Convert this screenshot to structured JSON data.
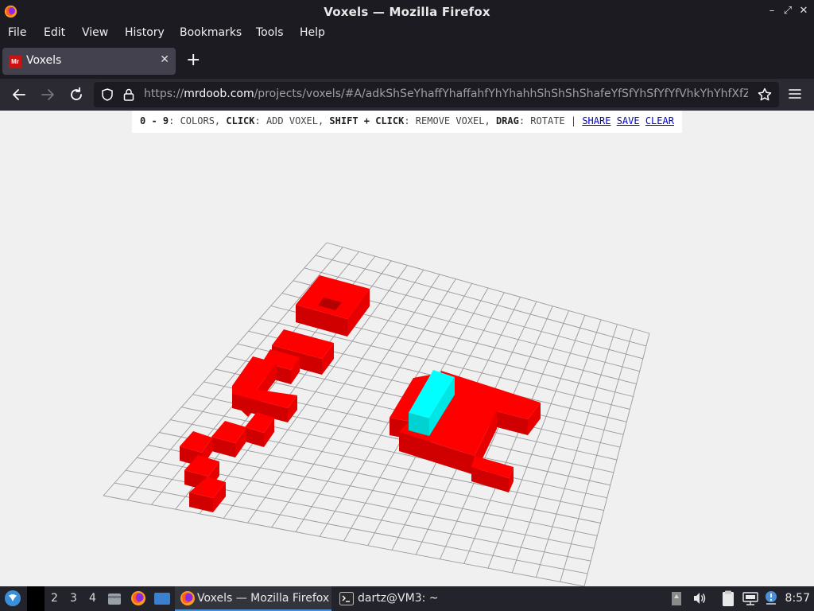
{
  "window": {
    "title": "Voxels — Mozilla Firefox"
  },
  "menu": [
    "File",
    "Edit",
    "View",
    "History",
    "Bookmarks",
    "Tools",
    "Help"
  ],
  "tab": {
    "label": "Voxels",
    "favicon_text": "Mr"
  },
  "url": {
    "prefix": "https://",
    "domain": "mrdoob.com",
    "path": "/projects/voxels/#A/adkShSeYhaffYhaffahfYhYhahhShShShShafeYfSfYhSfYfYfVhkYhYhfXfZ"
  },
  "info": {
    "k1": "0 - 9",
    "t1": ": COLORS, ",
    "k2": "CLICK",
    "t2": ": ADD VOXEL, ",
    "k3": "SHIFT + CLICK",
    "t3": ": REMOVE VOXEL, ",
    "k4": "DRAG",
    "t4": ": ROTATE | ",
    "share": "SHARE",
    "save": "SAVE",
    "clear": "CLEAR"
  },
  "colors": {
    "voxel_red": "#ff0000",
    "voxel_cyan": "#00ffff",
    "grid_line": "#9a9a9a",
    "background": "#f0f0f0"
  },
  "taskbar": {
    "workspaces": [
      "2",
      "3",
      "4"
    ],
    "tasks": [
      {
        "label": "Voxels — Mozilla Firefox",
        "icon": "firefox-icon",
        "active": true
      },
      {
        "label": "dartz@VM3: ~",
        "icon": "terminal-icon",
        "active": false
      }
    ],
    "clock": "8:57"
  }
}
